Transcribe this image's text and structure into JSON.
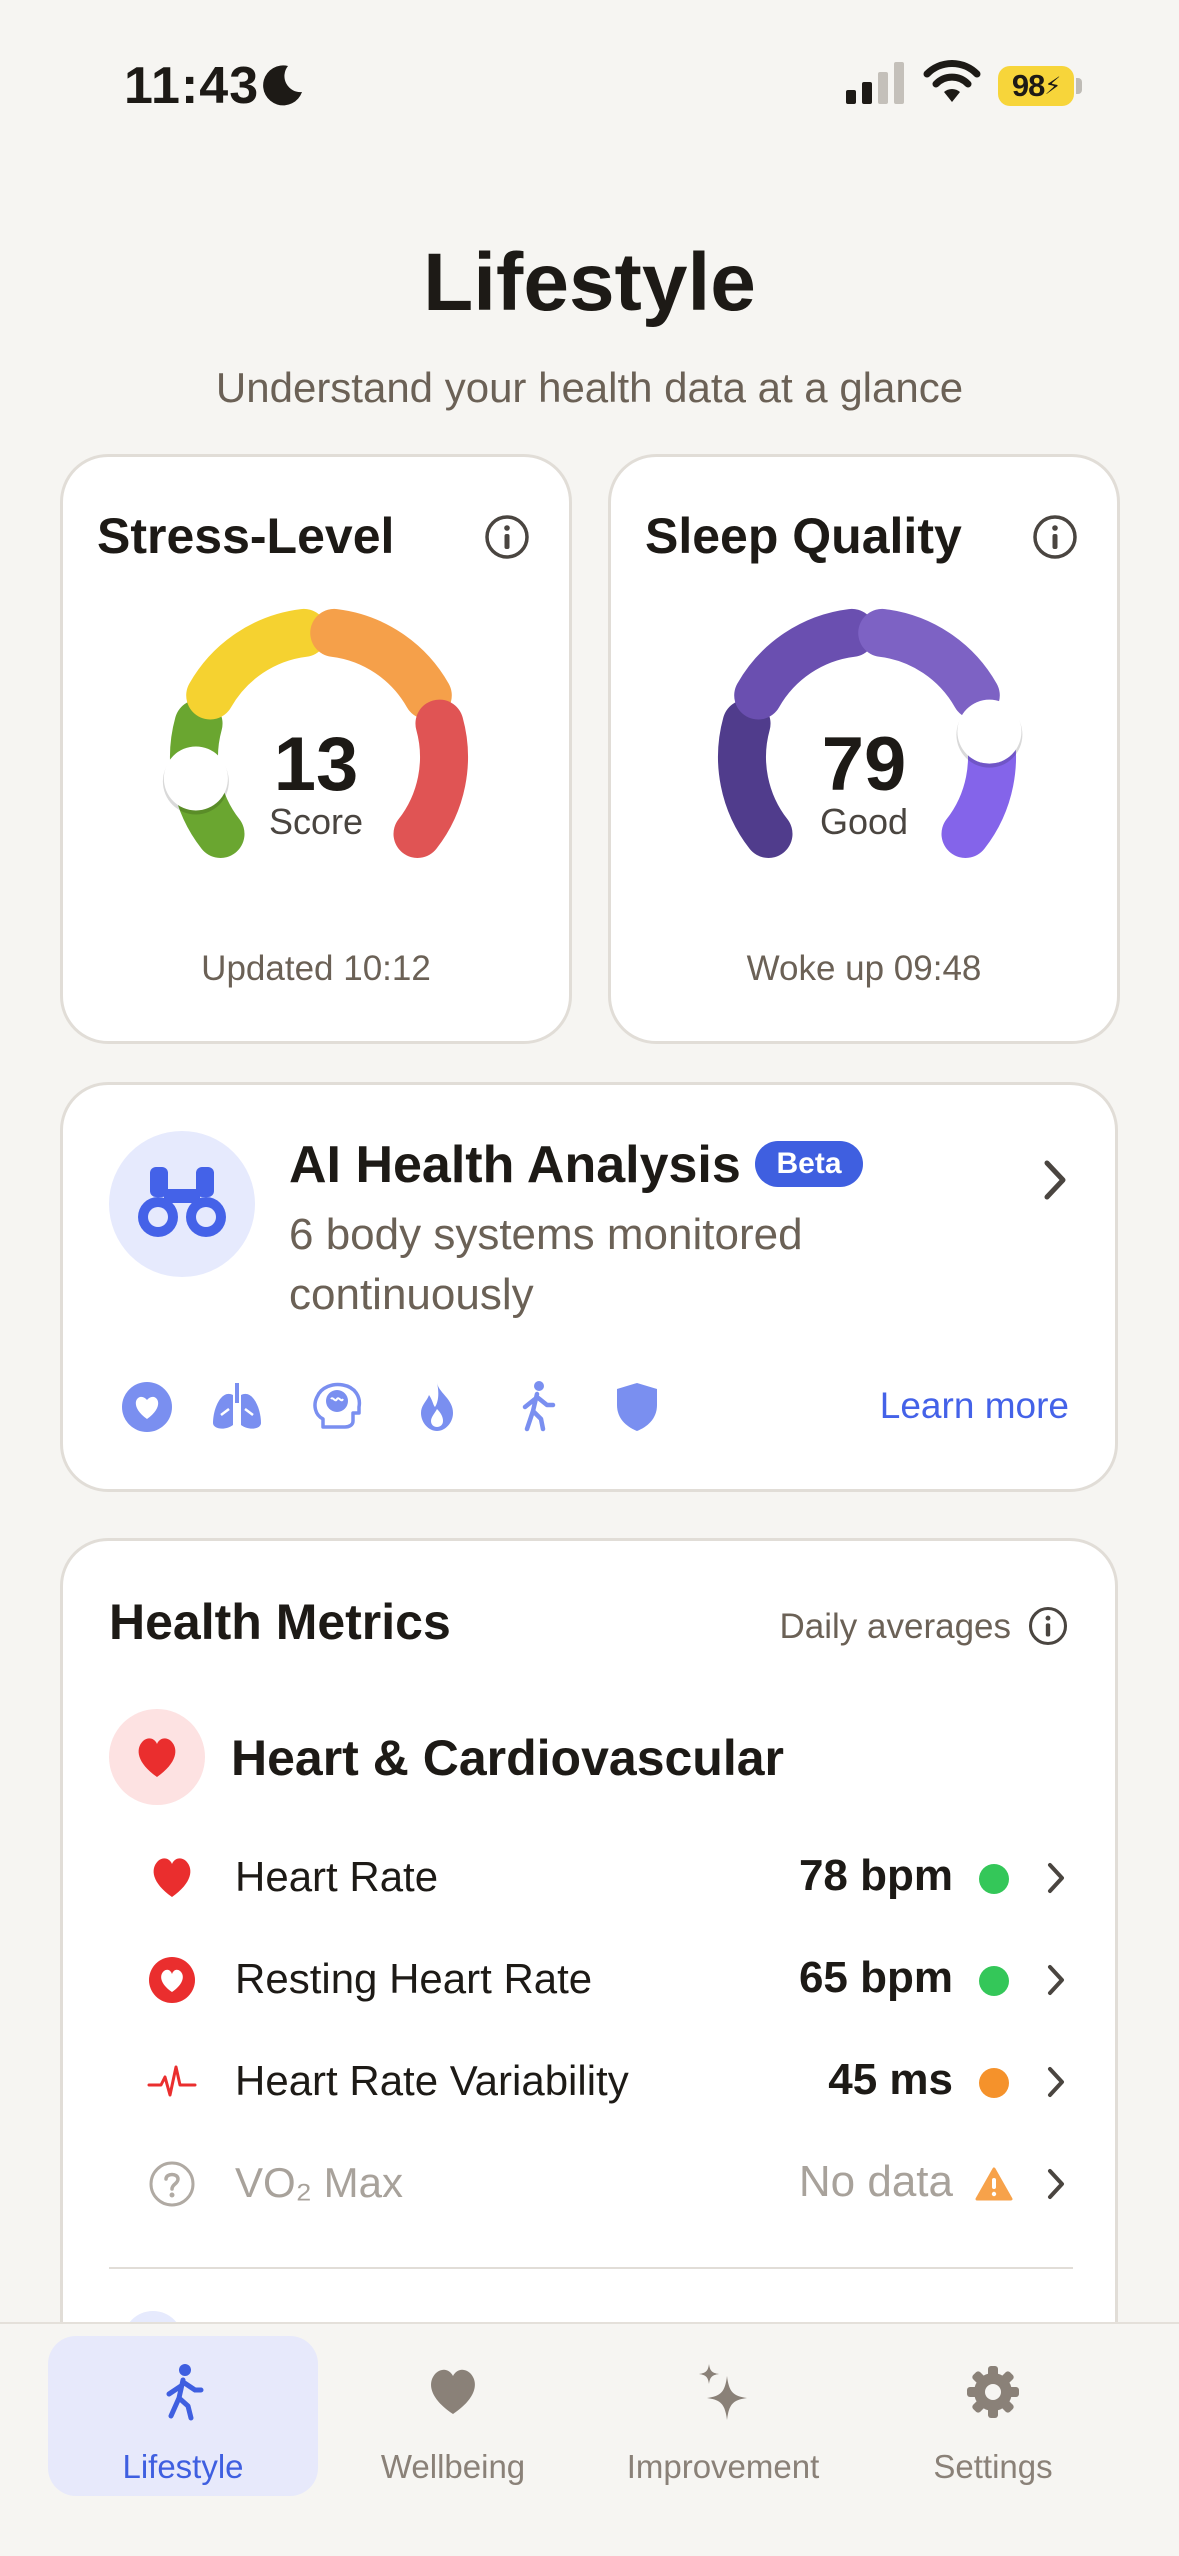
{
  "status_bar": {
    "time": "11:43",
    "battery": "98"
  },
  "header": {
    "title": "Lifestyle",
    "subtitle": "Understand your health data at a glance"
  },
  "gauges": {
    "stress": {
      "title": "Stress-Level",
      "value": "13",
      "label": "Score",
      "footer": "Updated 10:12",
      "level": 0.13,
      "colors": [
        "#6aa630",
        "#f5d230",
        "#f5a04a",
        "#e05454"
      ]
    },
    "sleep": {
      "title": "Sleep Quality",
      "value": "79",
      "label": "Good",
      "footer": "Woke up 09:48",
      "level": 0.79,
      "colors": [
        "#503c8c",
        "#6a4fb0",
        "#7d62c4",
        "#8464ea"
      ]
    }
  },
  "ai_card": {
    "title": "AI Health Analysis",
    "badge": "Beta",
    "description": "6 body systems monitored continuously",
    "link": "Learn more",
    "system_icons": [
      "heart-icon",
      "lungs-icon",
      "brain-icon",
      "flame-icon",
      "walking-icon",
      "shield-icon"
    ],
    "accent": "#4462e8"
  },
  "metrics": {
    "title": "Health Metrics",
    "subtitle": "Daily averages",
    "category": "Heart & Cardiovascular",
    "rows": [
      {
        "name": "Heart Rate",
        "value": "78 bpm",
        "status": "good",
        "icon": "heart-icon"
      },
      {
        "name": "Resting Heart Rate",
        "value": "65 bpm",
        "status": "good",
        "icon": "heart-circle-icon"
      },
      {
        "name": "Heart Rate Variability",
        "value": "45 ms",
        "status": "moderate",
        "icon": "pulse-icon"
      },
      {
        "name": "VO₂ Max",
        "value": "No data",
        "status": "warning",
        "icon": "question-icon"
      }
    ],
    "status_colors": {
      "good": "#34c759",
      "moderate": "#f5922b",
      "warning": "#f7a24a"
    }
  },
  "tabbar": {
    "tabs": [
      {
        "label": "Lifestyle",
        "active": true
      },
      {
        "label": "Wellbeing",
        "active": false
      },
      {
        "label": "Improvement",
        "active": false
      },
      {
        "label": "Settings",
        "active": false
      }
    ]
  }
}
